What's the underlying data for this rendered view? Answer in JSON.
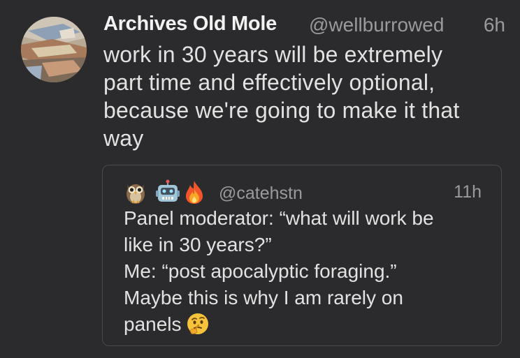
{
  "tweet": {
    "display_name": "Archives Old Mole",
    "handle": "@wellburrowed",
    "timestamp": "6h",
    "text": "work in 30 years will be extremely\npart time and effectively optional,\nbecause we're going to make it that\nway",
    "avatar_icon": "collage-avatar"
  },
  "quoted_tweet": {
    "name_emojis": [
      "owl-emoji",
      "robot-emoji",
      "fire-emoji"
    ],
    "handle": "@catehstn",
    "timestamp": "11h",
    "text": "Panel moderator: “what will work be\nlike in 30 years?”\nMe: “post apocalyptic foraging.”\nMaybe this is why I am rarely on\npanels",
    "trailing_emoji": "thinking-face-emoji"
  },
  "colors": {
    "background": "#2b2b2d",
    "primary_text": "#e2e2e2",
    "secondary_text": "#9a9a9e",
    "card_border": "#4a4a4e"
  }
}
